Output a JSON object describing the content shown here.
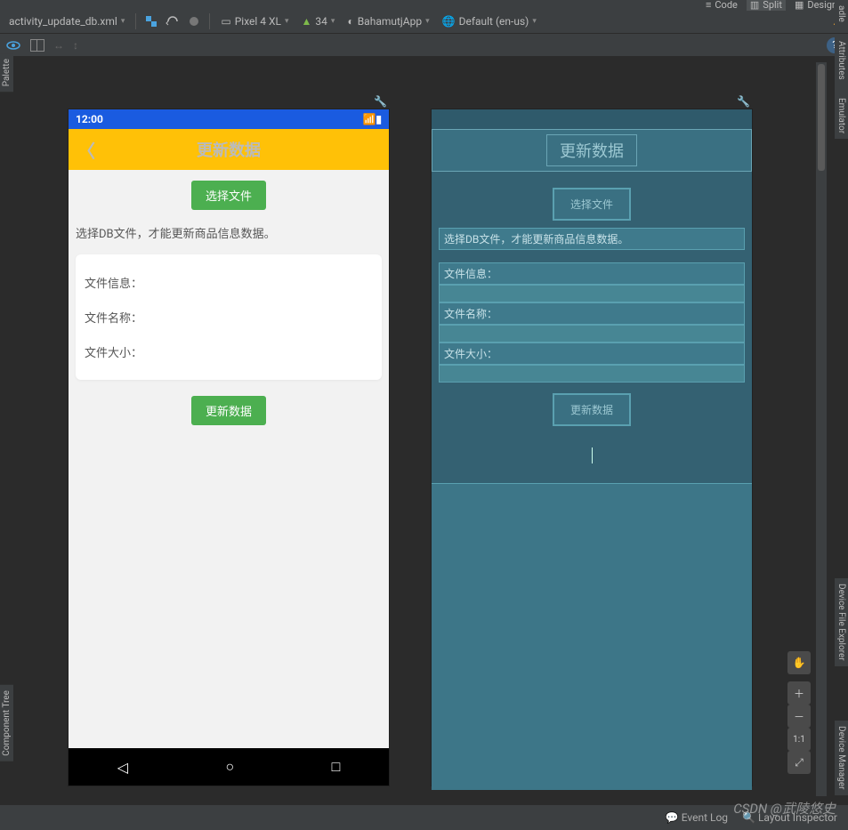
{
  "top_tabs": {
    "code": "Code",
    "split": "Split",
    "design": "Design"
  },
  "toolbar": {
    "filename": "activity_update_db.xml",
    "device": "Pixel 4 XL",
    "api": "34",
    "app": "BahamutjApp",
    "locale": "Default (en-us)"
  },
  "side": {
    "palette": "Palette",
    "component_tree": "Component Tree",
    "gradle": "adle",
    "attributes": "Attributes",
    "emulator": "Emulator",
    "device_file_explorer": "Device File Explorer",
    "device_manager": "Device Manager"
  },
  "preview": {
    "time": "12:00",
    "title": "更新数据",
    "select_file": "选择文件",
    "hint": "选择DB文件，才能更新商品信息数据。",
    "file_info": "文件信息：",
    "file_name": "文件名称：",
    "file_size": "文件大小：",
    "update_btn": "更新数据"
  },
  "zoom": {
    "ratio": "1:1"
  },
  "statusbar": {
    "event_log": "Event Log",
    "layout_inspector": "Layout Inspector"
  },
  "watermark": "CSDN @武陵悠史"
}
